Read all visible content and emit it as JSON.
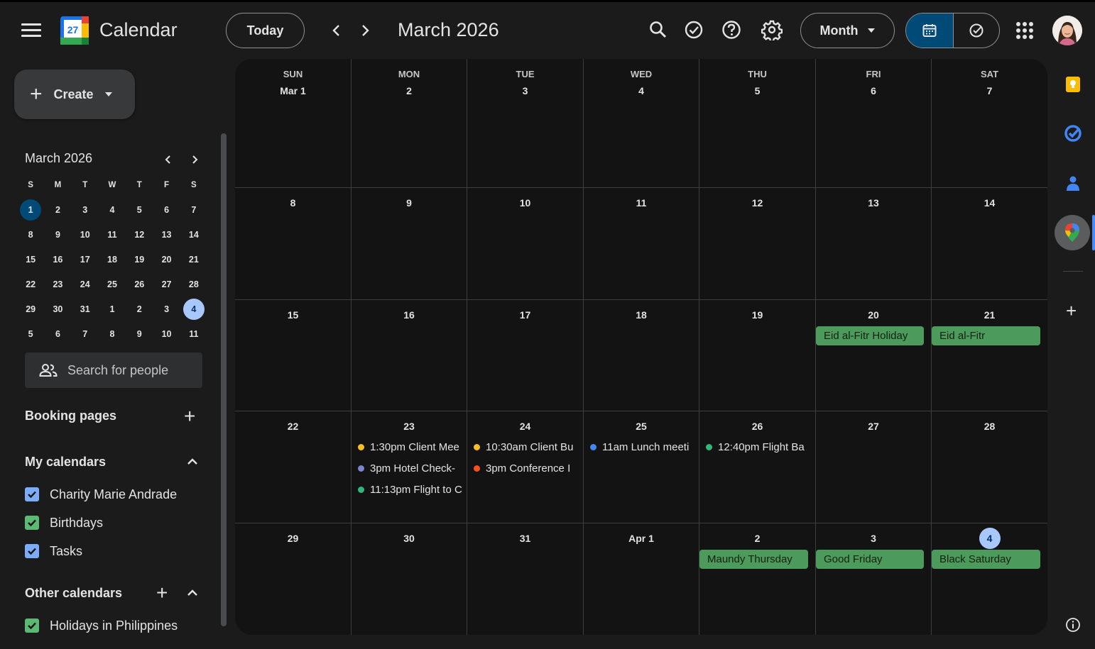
{
  "header": {
    "app_title": "Calendar",
    "logo_number": "27",
    "today_label": "Today",
    "period_title": "March 2026",
    "view_label": "Month"
  },
  "sidebar": {
    "create_label": "Create",
    "mini_calendar": {
      "title": "March 2026",
      "weekdays": [
        "S",
        "M",
        "T",
        "W",
        "T",
        "F",
        "S"
      ],
      "weeks": [
        [
          "1",
          "2",
          "3",
          "4",
          "5",
          "6",
          "7"
        ],
        [
          "8",
          "9",
          "10",
          "11",
          "12",
          "13",
          "14"
        ],
        [
          "15",
          "16",
          "17",
          "18",
          "19",
          "20",
          "21"
        ],
        [
          "22",
          "23",
          "24",
          "25",
          "26",
          "27",
          "28"
        ],
        [
          "29",
          "30",
          "31",
          "1",
          "2",
          "3",
          "4"
        ],
        [
          "5",
          "6",
          "7",
          "8",
          "9",
          "10",
          "11"
        ]
      ],
      "current_day": "1",
      "selected_day": "4"
    },
    "search_people": "Search for people",
    "booking_pages": "Booking pages",
    "my_calendars": {
      "title": "My calendars",
      "items": [
        {
          "label": "Charity Marie Andrade",
          "color": "#7cacf8"
        },
        {
          "label": "Birthdays",
          "color": "#5bb974"
        },
        {
          "label": "Tasks",
          "color": "#7cacf8"
        }
      ]
    },
    "other_calendars": {
      "title": "Other calendars",
      "items": [
        {
          "label": "Holidays in Philippines",
          "color": "#5bb974"
        }
      ]
    }
  },
  "calendar": {
    "weekdays": [
      "SUN",
      "MON",
      "TUE",
      "WED",
      "THU",
      "FRI",
      "SAT"
    ],
    "weeks": [
      {
        "days": [
          "Mar 1",
          "2",
          "3",
          "4",
          "5",
          "6",
          "7"
        ],
        "allday": [],
        "events": []
      },
      {
        "days": [
          "8",
          "9",
          "10",
          "11",
          "12",
          "13",
          "14"
        ],
        "allday": [],
        "events": []
      },
      {
        "days": [
          "15",
          "16",
          "17",
          "18",
          "19",
          "20",
          "21"
        ],
        "allday": [
          {
            "day": 5,
            "label": "Eid al-Fitr Holiday"
          },
          {
            "day": 6,
            "label": "Eid al-Fitr"
          }
        ],
        "events": []
      },
      {
        "days": [
          "22",
          "23",
          "24",
          "25",
          "26",
          "27",
          "28"
        ],
        "allday": [],
        "events": [
          {
            "day": 1,
            "row": 0,
            "label": "1:30pm Client Mee",
            "color": "#f6bf26"
          },
          {
            "day": 1,
            "row": 1,
            "label": "3pm Hotel Check-",
            "color": "#7986cb"
          },
          {
            "day": 1,
            "row": 2,
            "label": "11:13pm Flight to C",
            "color": "#33b679"
          },
          {
            "day": 2,
            "row": 0,
            "label": "10:30am Client Bu",
            "color": "#f6bf26"
          },
          {
            "day": 2,
            "row": 1,
            "label": "3pm Conference I",
            "color": "#f4511e"
          },
          {
            "day": 3,
            "row": 0,
            "label": "11am Lunch meeti",
            "color": "#4285f4"
          },
          {
            "day": 4,
            "row": 0,
            "label": "12:40pm Flight Ba",
            "color": "#33b679"
          }
        ]
      },
      {
        "days": [
          "29",
          "30",
          "31",
          "Apr 1",
          "2",
          "3",
          "4"
        ],
        "allday": [
          {
            "day": 4,
            "label": "Maundy Thursday"
          },
          {
            "day": 5,
            "label": "Good Friday"
          },
          {
            "day": 6,
            "label": "Black Saturday"
          }
        ],
        "events": [],
        "today_index": 6
      }
    ]
  },
  "colors": {
    "background": "#1b1b1b",
    "surface": "#131314",
    "accent": "#a8c7fa",
    "holiday": "#4d9a5d"
  },
  "icons": [
    "menu-icon",
    "search-icon",
    "task-check-icon",
    "help-icon",
    "settings-icon",
    "calendar-icon",
    "tasks-icon",
    "apps-icon",
    "keep-icon",
    "tasks-app-icon",
    "contacts-icon",
    "maps-icon",
    "info-icon"
  ]
}
